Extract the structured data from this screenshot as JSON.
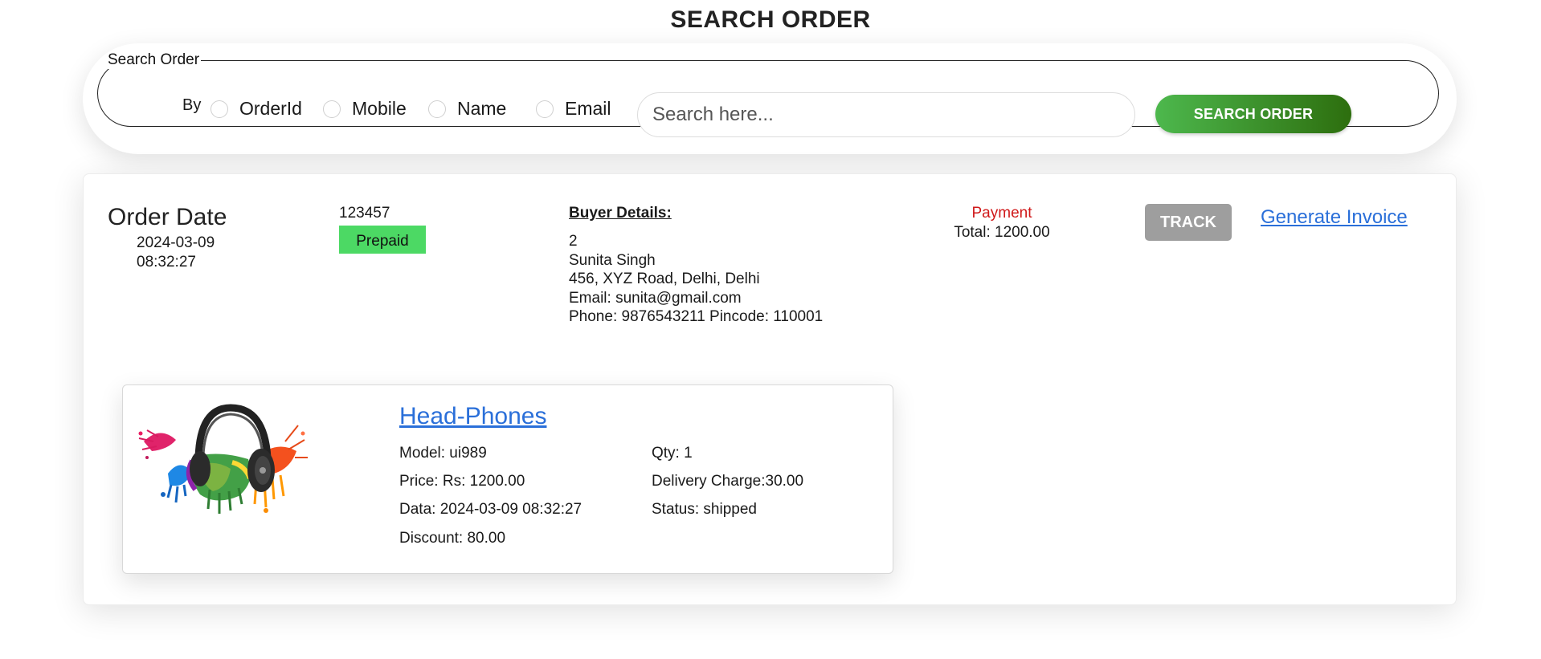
{
  "page": {
    "title": "SEARCH ORDER"
  },
  "search": {
    "legend": "Search Order",
    "by_label": "By",
    "options": [
      "OrderId",
      "Mobile",
      "Name",
      "Email"
    ],
    "placeholder": "Search here...",
    "button_label": "SEARCH ORDER"
  },
  "order": {
    "date_title": "Order Date",
    "date_value": "2024-03-09 08:32:27",
    "order_id": "123457",
    "payment_mode_badge": "Prepaid",
    "buyer_heading": "Buyer Details:",
    "buyer": {
      "id": "2",
      "name": "Sunita Singh",
      "address": "456, XYZ Road, Delhi, Delhi",
      "email": "Email: sunita@gmail.com",
      "phone_pincode": "Phone: 9876543211 Pincode: 110001"
    },
    "payment_label": "Payment",
    "payment_total": "Total: 1200.00",
    "track_label": "TRACK",
    "invoice_label": "Generate Invoice"
  },
  "product": {
    "name": "Head-Phones",
    "image_icon": "headphones-icon",
    "model": "Model: ui989",
    "price": "Price: Rs: 1200.00",
    "data": "Data: 2024-03-09 08:32:27",
    "discount": "Discount: 80.00",
    "qty": "Qty: 1",
    "delivery": "Delivery Charge:30.00",
    "status": "Status: shipped"
  },
  "colors": {
    "search_button_start": "#4db84d",
    "search_button_end": "#2d6e0e",
    "prepaid_badge": "#4cd964",
    "payment_label": "#d0191a",
    "track_button": "#9e9e9e",
    "link": "#2a6fd9"
  }
}
